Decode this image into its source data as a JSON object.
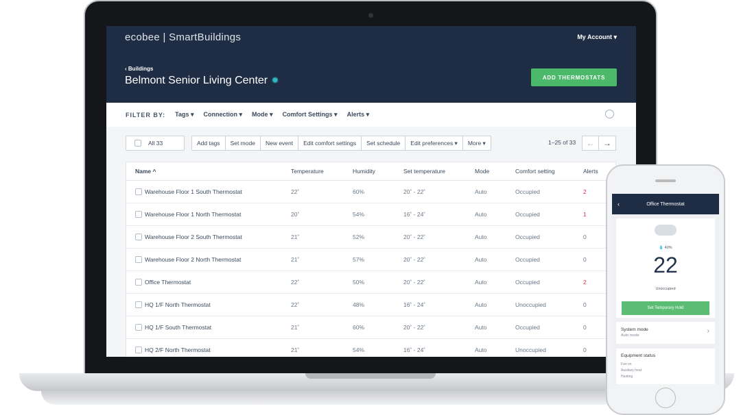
{
  "header": {
    "logo": "ecobee | SmartBuildings",
    "account": "My Account ▾",
    "breadcrumb": "‹ Buildings",
    "title": "Belmont Senior Living Center",
    "add_button": "ADD THERMOSTATS"
  },
  "filter": {
    "label": "FILTER BY:",
    "items": [
      "Tags ▾",
      "Connection ▾",
      "Mode ▾",
      "Comfort Settings ▾",
      "Alerts ▾"
    ]
  },
  "toolbar": {
    "select_all": "All 33",
    "actions": [
      "Add tags",
      "Set mode",
      "New event",
      "Edit comfort settings",
      "Set schedule",
      "Edit preferences ▾",
      "More ▾"
    ],
    "pagination": "1–25 of 33"
  },
  "table": {
    "headers": [
      "Name ^",
      "Temperature",
      "Humidity",
      "Set temperature",
      "Mode",
      "Comfort setting",
      "Alerts"
    ],
    "rows": [
      [
        "Warehouse Floor 1 South Thermostat",
        "22˚",
        "60%",
        "20˚ - 22˚",
        "Auto",
        "Occupied",
        "2"
      ],
      [
        "Warehouse Floor 1 North Thermostat",
        "20˚",
        "54%",
        "16˚ - 24˚",
        "Auto",
        "Occupied",
        "1"
      ],
      [
        "Warehouse Floor 2 South Thermostat",
        "21˚",
        "52%",
        "20˚ - 22˚",
        "Auto",
        "Occupied",
        "0"
      ],
      [
        "Warehouse Floor 2 North Thermostat",
        "21˚",
        "57%",
        "20˚ - 22˚",
        "Auto",
        "Occupied",
        "0"
      ],
      [
        "Office Thermostat",
        "22˚",
        "50%",
        "20˚ - 22˚",
        "Auto",
        "Occupied",
        "2"
      ],
      [
        "HQ 1/F North Thermostat",
        "22˚",
        "48%",
        "16˚ - 24˚",
        "Auto",
        "Unoccupied",
        "0"
      ],
      [
        "HQ 1/F South Thermostat",
        "21˚",
        "60%",
        "20˚ - 22˚",
        "Auto",
        "Occupied",
        "0"
      ],
      [
        "HQ 2/F North Thermostat",
        "21˚",
        "54%",
        "16˚ - 24˚",
        "Auto",
        "Unoccupied",
        "0"
      ]
    ]
  },
  "phone": {
    "title": "Office Thermostat",
    "humidity": "💧 40%",
    "temperature": "22",
    "comfort": "Unoccupied",
    "hold_button": "Set Temporary Hold",
    "system_mode_label": "System mode",
    "system_mode_value": "Auto mode",
    "equipment_label": "Equipment status",
    "equipment": [
      "Fan on",
      "Auxiliary heat",
      "Heating"
    ]
  },
  "colors": {
    "header": "#1f2d44",
    "accent_green": "#4cb86a",
    "alert_red": "#e5294a",
    "gear": "#2fb6c2"
  }
}
